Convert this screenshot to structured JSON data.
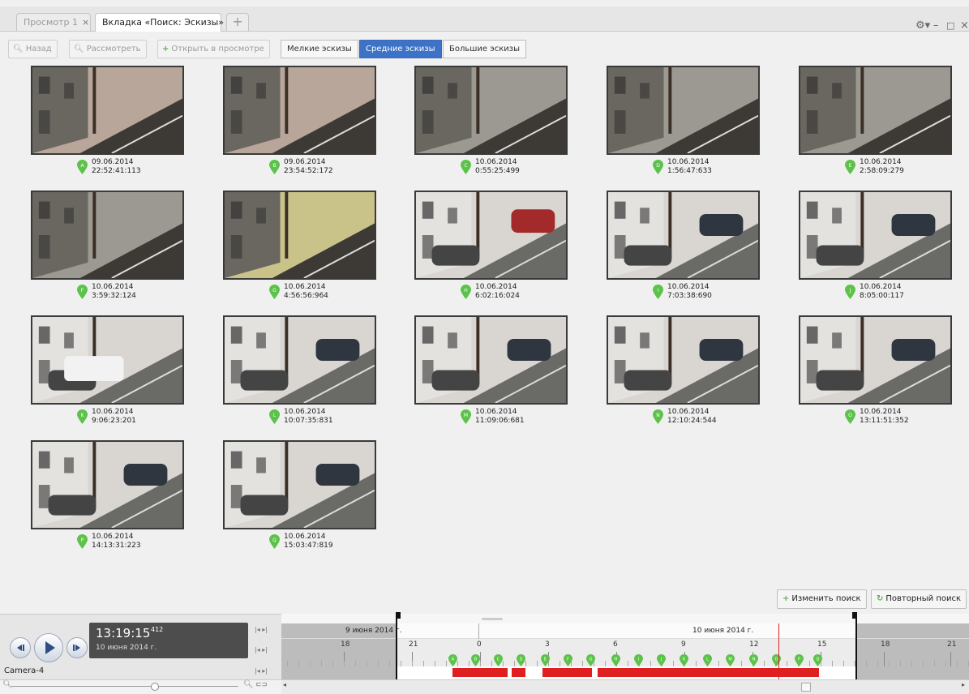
{
  "tabs": [
    {
      "label": "Просмотр 1",
      "close": "×",
      "active": false
    },
    {
      "label": "Вкладка «Поиск: Эскизы»",
      "close": "×",
      "active": true
    }
  ],
  "add_tab": "+",
  "window_controls": {
    "settings": "⚙▾",
    "minimize": "–",
    "maximize": "□",
    "close": "×"
  },
  "toolbar": {
    "back": "Назад",
    "inspect": "Рассмотреть",
    "open_in_view": "Открыть в просмотре",
    "size_small": "Мелкие эскизы",
    "size_medium": "Средние эскизы",
    "size_large": "Большие эскизы",
    "selected_size": "Средние эскизы"
  },
  "thumbnails": [
    {
      "letter": "A",
      "date": "09.06.2014",
      "time": "22:52:41:113"
    },
    {
      "letter": "B",
      "date": "09.06.2014",
      "time": "23:54:52:172"
    },
    {
      "letter": "C",
      "date": "10.06.2014",
      "time": "0:55:25:499"
    },
    {
      "letter": "D",
      "date": "10.06.2014",
      "time": "1:56:47:633"
    },
    {
      "letter": "E",
      "date": "10.06.2014",
      "time": "2:58:09:279"
    },
    {
      "letter": "F",
      "date": "10.06.2014",
      "time": "3:59:32:124"
    },
    {
      "letter": "G",
      "date": "10.06.2014",
      "time": "4:56:56:964"
    },
    {
      "letter": "H",
      "date": "10.06.2014",
      "time": "6:02:16:024"
    },
    {
      "letter": "I",
      "date": "10.06.2014",
      "time": "7:03:38:690"
    },
    {
      "letter": "J",
      "date": "10.06.2014",
      "time": "8:05:00:117"
    },
    {
      "letter": "K",
      "date": "10.06.2014",
      "time": "9:06:23:201"
    },
    {
      "letter": "L",
      "date": "10.06.2014",
      "time": "10:07:35:831"
    },
    {
      "letter": "M",
      "date": "10.06.2014",
      "time": "11:09:06:681"
    },
    {
      "letter": "N",
      "date": "10.06.2014",
      "time": "12:10:24:544"
    },
    {
      "letter": "O",
      "date": "10.06.2014",
      "time": "13:11:51:352"
    },
    {
      "letter": "P",
      "date": "10.06.2014",
      "time": "14:13:31:223"
    },
    {
      "letter": "Q",
      "date": "10.06.2014",
      "time": "15:03:47:819"
    }
  ],
  "actions": {
    "change_search": "Изменить поиск",
    "repeat_search": "Повторный поиск"
  },
  "player": {
    "time": "13:19:15",
    "ms": "412",
    "date": "10 июня 2014 г.",
    "camera": "Camera-4"
  },
  "timeline": {
    "day1": "9 июня 2014 г.",
    "day2": "10 июня 2014 г.",
    "hours": [
      "18",
      "21",
      "0",
      "3",
      "6",
      "9",
      "12",
      "15",
      "18",
      "21"
    ],
    "markers": [
      "A",
      "B",
      "C",
      "D",
      "E",
      "F",
      "G",
      "H",
      "I",
      "J",
      "K",
      "L",
      "M",
      "N",
      "O",
      "P",
      "Q"
    ]
  },
  "colors": {
    "accent": "#3d73c6",
    "marker": "#5cc24a",
    "recording": "#e02020",
    "time_panel": "#4d4d4d"
  }
}
